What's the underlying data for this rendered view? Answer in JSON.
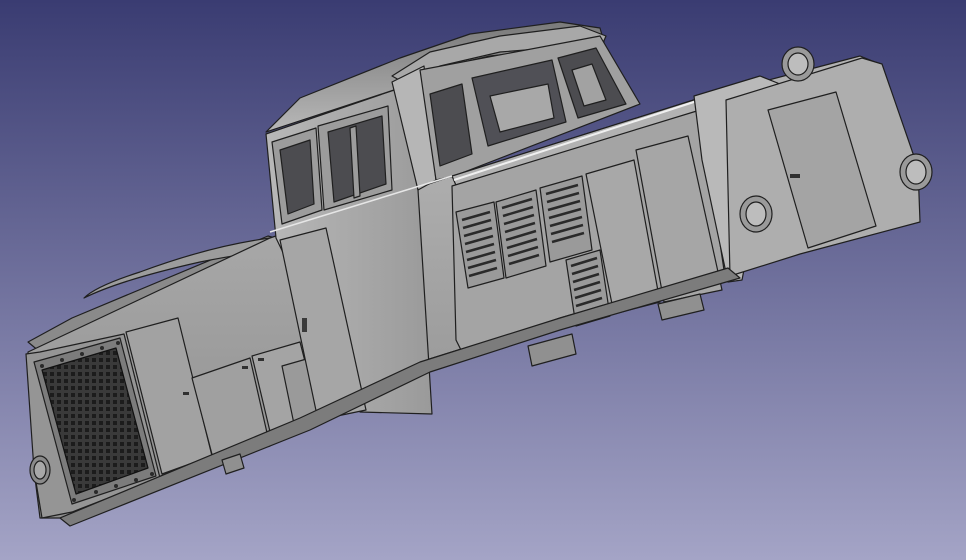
{
  "viewport": {
    "background_top": "#3a3c72",
    "background_bottom": "#a4a4c6",
    "corner_mark": ""
  },
  "model": {
    "body_color": "#a9a9a9",
    "shadow_color": "#6f6f6f",
    "highlight_color": "#d4d4d4",
    "edge_color": "#1f1f1f",
    "glass_color": "#4c4c50"
  }
}
